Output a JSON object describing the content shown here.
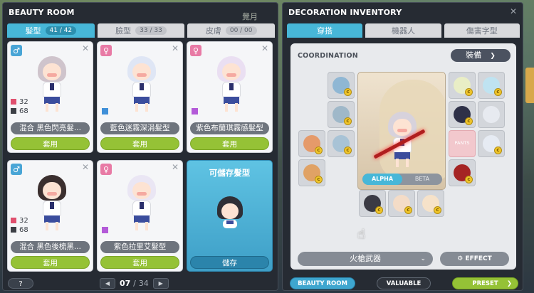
{
  "beauty_room": {
    "title": "BEAUTY ROOM",
    "tabs": [
      {
        "label": "髮型",
        "count": "41 / 42"
      },
      {
        "label": "臉型",
        "count": "33 / 33"
      },
      {
        "label": "皮膚",
        "count": "00 / 00"
      }
    ],
    "cards": [
      {
        "gender": "♂",
        "name": "混合 黑色閃亮髮...",
        "stat1": "32",
        "stat2": "68",
        "apply": "套用",
        "stat1_color": "#e0506e",
        "stat2_color": "#3c3f45",
        "hair_color": "#cfc4cc"
      },
      {
        "gender": "♀",
        "name": "藍色迷霧深涓髮型",
        "apply": "套用",
        "swatch_color": "#3f8fd8",
        "hair_color": "#dfe6f5"
      },
      {
        "gender": "♀",
        "name": "紫色布蘭琪霧感髮型",
        "apply": "套用",
        "swatch_color": "#b35ad8",
        "hair_color": "#eadff2"
      },
      {
        "gender": "♂",
        "name": "混合 黑色後梳黑...",
        "stat1": "32",
        "stat2": "68",
        "apply": "套用",
        "stat1_color": "#e0506e",
        "stat2_color": "#3c3f45",
        "hair_color": "#3b2f2f"
      },
      {
        "gender": "♀",
        "name": "紫色拉里艾髮型",
        "apply": "套用",
        "swatch_color": "#b35ad8",
        "hair_color": "#eae6f4"
      }
    ],
    "save_card": {
      "title": "可儲存髮型",
      "button": "儲存"
    },
    "help": "?",
    "pager": {
      "current": "07",
      "separator": "/",
      "total": "34",
      "prev": "◀",
      "next": "▶"
    }
  },
  "decoration_inventory": {
    "title": "DECORATION INVENTORY",
    "close": "✕",
    "tabs": [
      {
        "label": "穿搭"
      },
      {
        "label": "機器人"
      },
      {
        "label": "傷害字型"
      }
    ],
    "coordination_label": "COORDINATION",
    "equip_button": "裝備",
    "pants_slot_label": "PANTS",
    "alpha": "ALPHA",
    "beta": "BETA",
    "weapon_select": "火槍武器",
    "effect_button": "EFFECT",
    "bottom": {
      "beauty_room": "BEAUTY ROOM",
      "valuable": "VALUABLE",
      "preset": "PRESET"
    }
  },
  "background": {
    "title_partial": "覺月"
  },
  "colors": {
    "accent_blue": "#47b7d8",
    "accent_green": "#95c236",
    "panel_dark": "#262b33"
  }
}
